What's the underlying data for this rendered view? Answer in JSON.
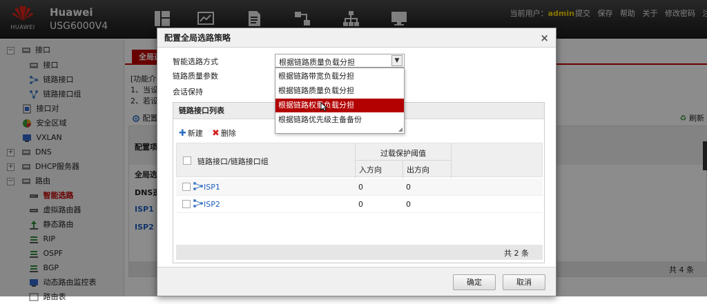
{
  "header": {
    "logo_text": "HUAWEI",
    "brand": "Huawei",
    "model": "USG6000V4",
    "nav_icons": [
      "dashboard-icon",
      "monitor-chart-icon",
      "policy-document-icon",
      "objects-icon",
      "network-topology-icon",
      "system-screen-icon"
    ],
    "current_user_label": "当前用户：",
    "username": "admin",
    "links": [
      "提交",
      "保存",
      "帮助",
      "关于",
      "修改密码",
      "注销"
    ]
  },
  "sidebar": {
    "items": [
      {
        "label": "接口",
        "toggle": "−",
        "icon": "interface-icon"
      },
      {
        "label": "接口",
        "icon": "interface-icon"
      },
      {
        "label": "链路接口",
        "icon": "link-interface-icon"
      },
      {
        "label": "链路接口组",
        "icon": "link-group-icon"
      },
      {
        "label": "接口对",
        "icon": "interface-pair-icon"
      },
      {
        "label": "安全区域",
        "icon": "security-zone-icon"
      },
      {
        "label": "VXLAN",
        "icon": "vxlan-icon"
      },
      {
        "label": "DNS",
        "toggle": "+",
        "icon": "dns-icon"
      },
      {
        "label": "DHCP服务器",
        "toggle": "+",
        "icon": "dhcp-icon"
      },
      {
        "label": "路由",
        "toggle": "−",
        "icon": "route-icon"
      },
      {
        "label": "智能选路",
        "icon": "smart-route-icon",
        "active": true
      },
      {
        "label": "虚拟路由器",
        "icon": "virtual-router-icon"
      },
      {
        "label": "静态路由",
        "icon": "static-route-icon"
      },
      {
        "label": "RIP",
        "icon": "rip-icon"
      },
      {
        "label": "OSPF",
        "icon": "ospf-icon"
      },
      {
        "label": "BGP",
        "icon": "bgp-icon"
      },
      {
        "label": "动态路由监控表",
        "icon": "route-monitor-icon"
      },
      {
        "label": "路由表",
        "icon": "route-table-icon"
      }
    ]
  },
  "main": {
    "tab_label": "全局选",
    "desc_lines": [
      "[功能介",
      "1、当设",
      "2、若设"
    ],
    "config_label": "配置",
    "refresh_label": "刷新",
    "table_header": "配置项",
    "rows": [
      "全局选",
      "DNS透",
      "ISP1",
      "ISP2"
    ],
    "footer_count": "共 4 条"
  },
  "modal": {
    "title": "配置全局选路策略",
    "close": "×",
    "fields": {
      "mode_label": "智能选路方式",
      "quality_label": "链路质量参数",
      "session_label": "会话保持"
    },
    "select": {
      "value": "根据链路质量负载分担",
      "options": [
        "根据链路带宽负载分担",
        "根据链路质量负载分担",
        "根据链路权重负载分担",
        "根据链路优先级主备备份"
      ],
      "highlighted_index": 2
    },
    "panel": {
      "title": "链路接口列表",
      "new_button": "新建",
      "delete_button": "删除",
      "col_name": "链路接口/链路接口组",
      "col_group": "过载保护阈值",
      "col_in": "入方向",
      "col_out": "出方向",
      "rows": [
        {
          "name": "ISP1",
          "in": "0",
          "out": "0"
        },
        {
          "name": "ISP2",
          "in": "0",
          "out": "0"
        }
      ],
      "footer_count": "共 2 条"
    },
    "ok_button": "确定",
    "cancel_button": "取消"
  },
  "colors": {
    "accent": "#c00000",
    "link": "#1e5fbf",
    "username": "#f5d400"
  }
}
